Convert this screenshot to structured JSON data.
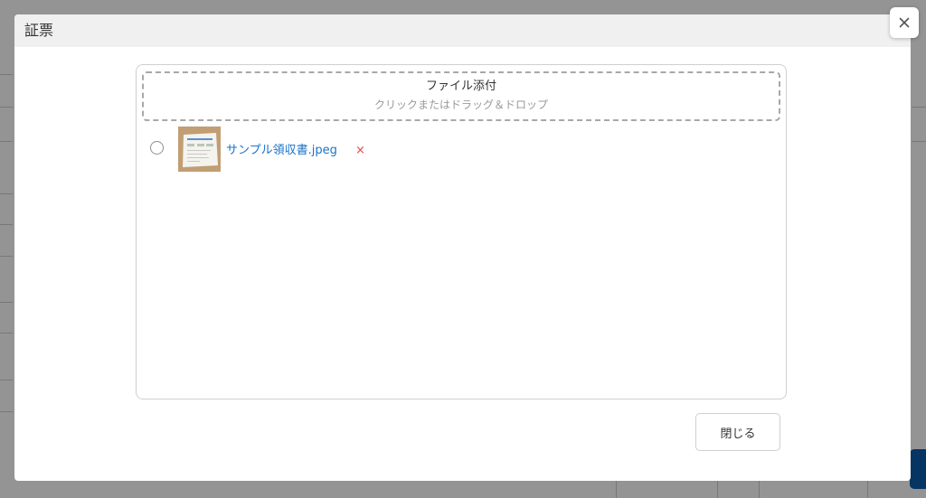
{
  "modal": {
    "title": "証票",
    "close_icon": "close-icon",
    "close_button_label": "閉じる"
  },
  "dropzone": {
    "title": "ファイル添付",
    "hint": "クリックまたはドラッグ＆ドロップ"
  },
  "files": [
    {
      "name": "サンプル領収書.jpeg",
      "remove_symbol": "×",
      "thumbnail_icon": "receipt-thumbnail"
    }
  ],
  "colors": {
    "link": "#1a73c8",
    "remove": "#e84545",
    "primary": "#0b5cad",
    "header_bg": "#f0f0f0"
  }
}
